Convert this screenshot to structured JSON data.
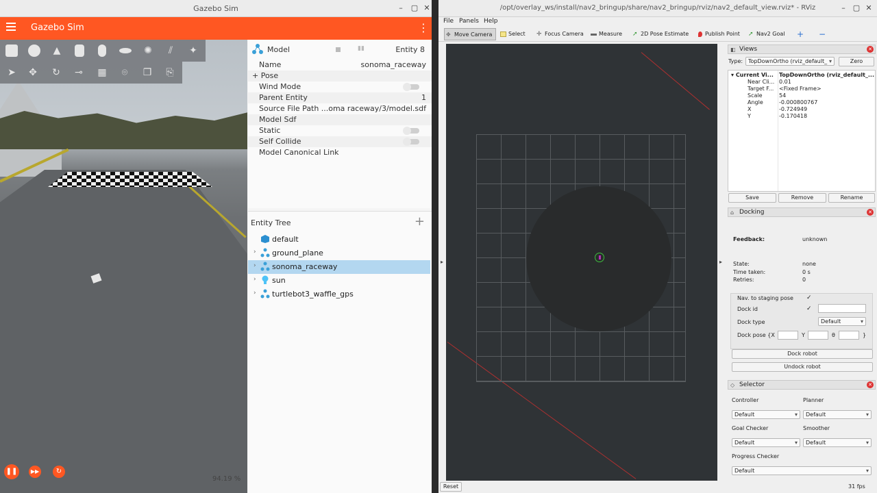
{
  "gazebo": {
    "window_title": "Gazebo Sim",
    "app_title": "Gazebo Sim",
    "rtf": "94.19 %",
    "inspector": {
      "title": "Model",
      "entity": "Entity 8",
      "props": [
        {
          "key": "Name",
          "value": "sonoma_raceway"
        },
        {
          "key": "+ Pose",
          "value": ""
        },
        {
          "key": "Wind Mode",
          "value": ""
        },
        {
          "key": "Parent Entity",
          "value": "1"
        },
        {
          "key": "Source File Path",
          "value": "...oma raceway/3/model.sdf"
        },
        {
          "key": "Model Sdf",
          "value": ""
        },
        {
          "key": "Static",
          "value": ""
        },
        {
          "key": "Self Collide",
          "value": ""
        },
        {
          "key": "Model Canonical Link",
          "value": ""
        }
      ]
    },
    "entity_tree": {
      "title": "Entity Tree",
      "items": [
        "default",
        "ground_plane",
        "sonoma_raceway",
        "sun",
        "turtlebot3_waffle_gps"
      ]
    }
  },
  "rviz": {
    "window_title": "/opt/overlay_ws/install/nav2_bringup/share/nav2_bringup/rviz/nav2_default_view.rviz* - RViz",
    "menu": [
      "File",
      "Panels",
      "Help"
    ],
    "tools": [
      "Move Camera",
      "Select",
      "Focus Camera",
      "Measure",
      "2D Pose Estimate",
      "Publish Point",
      "Nav2 Goal"
    ],
    "views": {
      "title": "Views",
      "type_label": "Type:",
      "type_value": "TopDownOrtho (rviz_default_",
      "zero": "Zero",
      "current_key": "Current Vi...",
      "current_value": "TopDownOrtho (rviz_default_...",
      "rows": [
        {
          "k": "Near Cli...",
          "v": "0.01"
        },
        {
          "k": "Target F...",
          "v": "<Fixed Frame>"
        },
        {
          "k": "Scale",
          "v": "54"
        },
        {
          "k": "Angle",
          "v": "-0.000800767"
        },
        {
          "k": "X",
          "v": "-0.724949"
        },
        {
          "k": "Y",
          "v": "-0.170418"
        }
      ],
      "save": "Save",
      "remove": "Remove",
      "rename": "Rename"
    },
    "docking": {
      "title": "Docking",
      "feedback_label": "Feedback:",
      "feedback_value": "unknown",
      "state_label": "State:",
      "state_value": "none",
      "time_label": "Time taken:",
      "time_value": "0 s",
      "retries_label": "Retries:",
      "retries_value": "0",
      "nav_staging": "Nav. to staging pose",
      "dock_id": "Dock id",
      "dock_type": "Dock type",
      "dock_type_value": "Default",
      "dock_pose": "Dock pose {X",
      "y_label": "Y",
      "theta_label": "θ",
      "close_brace": "}",
      "dock_btn": "Dock robot",
      "undock_btn": "Undock robot"
    },
    "selector": {
      "title": "Selector",
      "controller": "Controller",
      "planner": "Planner",
      "goal_checker": "Goal Checker",
      "smoother": "Smoother",
      "progress_checker": "Progress Checker",
      "default": "Default"
    },
    "reset": "Reset",
    "fps": "31 fps"
  }
}
